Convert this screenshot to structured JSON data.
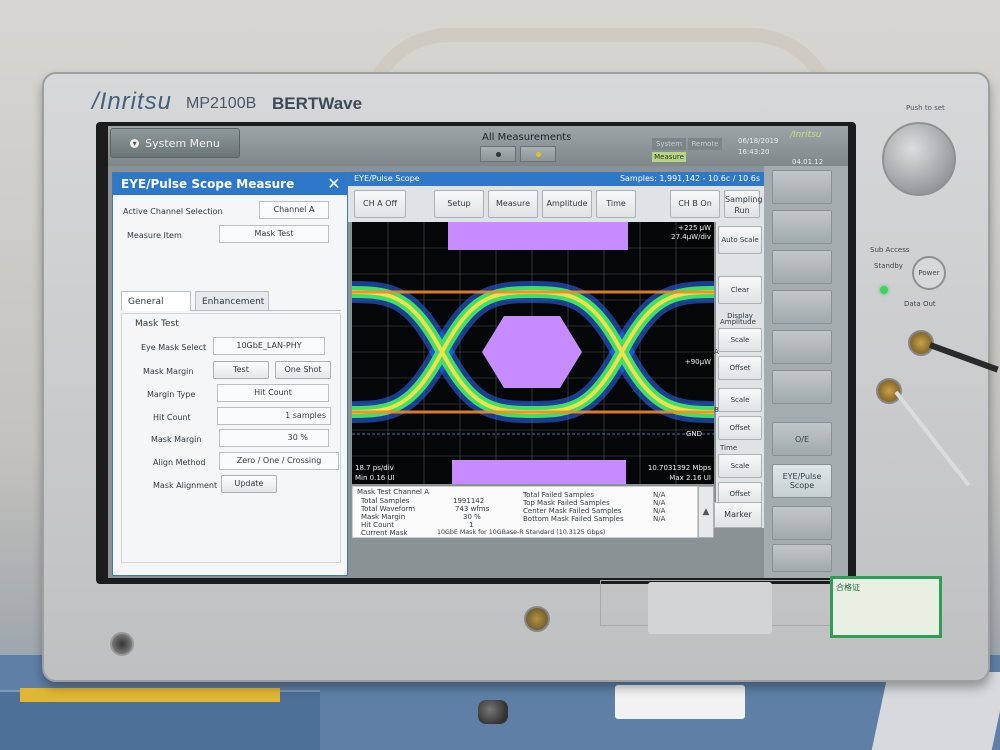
{
  "instrument": {
    "brand": "/Inritsu",
    "model": "MP2100B",
    "product": "BERTWave"
  },
  "topbar": {
    "system_menu_label": "System Menu",
    "all_measurements_label": "All Measurements",
    "system_tab": "System",
    "remote_tab": "Remote",
    "measure_badge": "Measure",
    "date": "06/18/2019",
    "time": "16:43:20",
    "brand_small": "/Inritsu",
    "version": "04.01.12"
  },
  "dialog": {
    "title": "EYE/Pulse Scope Measure",
    "close_glyph": "✕",
    "active_channel_label": "Active Channel Selection",
    "active_channel_value": "Channel A",
    "measure_item_label": "Measure Item",
    "measure_item_value": "Mask Test",
    "tabs": [
      "General",
      "Enhancement"
    ],
    "section_title": "Mask Test",
    "eye_mask_select_label": "Eye Mask Select",
    "eye_mask_select_value": "10GbE_LAN-PHY",
    "mask_margin_label": "Mask Margin",
    "mask_margin_test": "Test",
    "mask_margin_oneshot": "One Shot",
    "margin_type_label": "Margin Type",
    "margin_type_value": "Hit Count",
    "hit_count_label": "Hit Count",
    "hit_count_value": "1  samples",
    "mask_margin2_label": "Mask Margin",
    "mask_margin2_value": "30 %",
    "align_method_label": "Align Method",
    "align_method_value": "Zero / One / Crossing",
    "mask_alignment_label": "Mask Alignment",
    "mask_alignment_button": "Update"
  },
  "scope": {
    "header_left": "EYE/Pulse Scope",
    "header_right": "Samples: 1,991,142 - 10.6c / 10.6s",
    "toolbar": [
      "CH A Off",
      "Setup",
      "Measure",
      "Amplitude",
      "Time",
      "CH B On"
    ],
    "sampling_run": "Sampling Run",
    "side": {
      "auto_scale": "Auto Scale",
      "clear_display": "Clear Display",
      "amplitude_label": "Amplitude",
      "scale_a": "Scale",
      "offset_a": "Offset",
      "scale_b": "Scale",
      "offset_b": "Offset",
      "time_label": "Time",
      "scale_t": "Scale",
      "offset_t": "Offset",
      "marker": "Marker",
      "channel_a_tag": "A",
      "channel_b_tag": "B"
    },
    "plot_labels": {
      "top_right_1": "+225 µW",
      "top_right_2": "27.4µW/div",
      "ref_label": "+90µW",
      "gnd_label": "GND",
      "bottom_left_1": "18.7 ps/div",
      "bottom_left_2": "Min 0.16 UI",
      "bottom_right_1": "10.7031392 Mbps",
      "bottom_right_2": "Max 2.16 UI"
    },
    "results": {
      "heading": "Mask Test   Channel A",
      "rows_left": [
        {
          "label": "Total Samples",
          "value": "1991142"
        },
        {
          "label": "Total Waveform",
          "value": "743  wfms"
        },
        {
          "label": "Mask Margin",
          "value": "30  %"
        },
        {
          "label": "Hit Count",
          "value": "1"
        },
        {
          "label": "Current Mask",
          "value": "10GbE Mask for 10GBase-R Standard  (10.3125 Gbps)"
        }
      ],
      "rows_right": [
        {
          "label": "Total Failed Samples",
          "value": "N/A"
        },
        {
          "label": "Top Mask Failed Samples",
          "value": "N/A"
        },
        {
          "label": "Center Mask Failed Samples",
          "value": "N/A"
        },
        {
          "label": "Bottom Mask Failed Samples",
          "value": "N/A"
        }
      ]
    }
  },
  "softkeys": {
    "oe": "O/E",
    "eye_pulse_scope": "EYE/Pulse Scope"
  },
  "front_panel": {
    "power_label": "Push to set",
    "standby_label": "Standby",
    "power_button": "Power",
    "sub_access": "Sub Access",
    "data_out": "Data Out",
    "green_sticker": "合格证"
  },
  "colors": {
    "accent_blue": "#2e78c7",
    "mask_purple": "#c58bff",
    "eye_green": "#3ee06a",
    "eye_yellow": "#f1e04a",
    "eye_blue": "#2b6cff"
  }
}
